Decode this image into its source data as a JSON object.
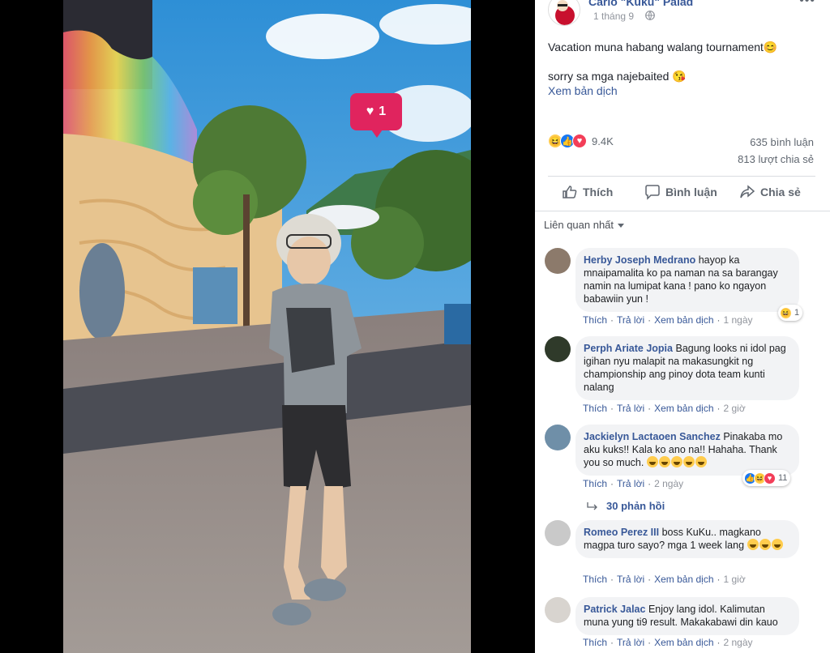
{
  "post": {
    "page_name": "Carlo \"Kuku\" Palad",
    "time": "1 tháng 9",
    "line1": "Vacation muna habang walang tournament😊",
    "line2": "sorry sa mga najebaited 😘",
    "translate": "Xem bản dịch",
    "reaction_count": "9.4K",
    "comments_count": "635 bình luận",
    "shares_count": "813 lượt chia sẻ"
  },
  "actions": {
    "like": "Thích",
    "comment": "Bình luận",
    "share": "Chia sẻ"
  },
  "sort_label": "Liên quan nhất",
  "photo": {
    "like_badge_count": "1"
  },
  "labels": {
    "like": "Thích",
    "reply": "Trả lời",
    "translate": "Xem bản dịch",
    "replies": "30 phản hồi"
  },
  "comments": [
    {
      "author": "Herby Joseph Medrano",
      "text": "hayop ka mnaipamalita ko pa naman na sa barangay namin na lumipat kana ! pano ko ngayon babawiin yun !",
      "age": "1 ngày",
      "reactions": "1"
    },
    {
      "author": "Perph Ariate Jopia",
      "text": "Bagung looks ni idol pag igihan nyu malapit na makasungkit ng championship ang pinoy dota team kunti nalang",
      "age": "2 giờ",
      "reactions": ""
    },
    {
      "author": "Jackielyn Lactaoen Sanchez",
      "text": "Pinakaba mo aku kuks!! Kala ko ano na!! Hahaha. Thank you so much.",
      "age": "2 ngày",
      "reactions": "11"
    },
    {
      "author": "Romeo Perez III",
      "text": "boss KuKu.. magkano magpa turo sayo? mga 1 week lang",
      "age": "1 giờ",
      "reactions": ""
    },
    {
      "author": "Patrick Jalac",
      "text": "Enjoy lang idol. Kalimutan muna yung ti9 result. Makakabawi din kauo",
      "age": "2 ngày",
      "reactions": ""
    }
  ],
  "colors": {
    "link": "#385898",
    "like_blue": "#1877f2",
    "heart_red": "#e0245e",
    "bubble": "#f2f3f5"
  }
}
